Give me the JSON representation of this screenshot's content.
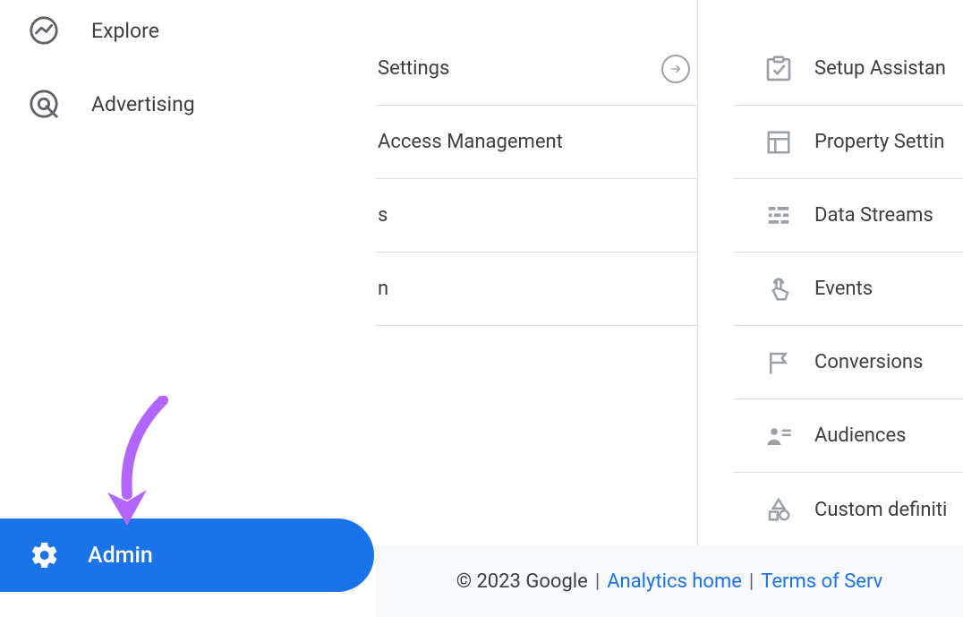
{
  "sidebar": {
    "explore_label": "Explore",
    "advertising_label": "Advertising",
    "admin_label": "Admin"
  },
  "middle": {
    "items": [
      {
        "label": "Settings",
        "show_move": true
      },
      {
        "label": "Access Management"
      },
      {
        "label": "s"
      },
      {
        "label": "n"
      }
    ]
  },
  "right": {
    "items": [
      {
        "label": "Setup Assistan"
      },
      {
        "label": "Property Settin"
      },
      {
        "label": "Data Streams"
      },
      {
        "label": "Events"
      },
      {
        "label": "Conversions"
      },
      {
        "label": "Audiences"
      },
      {
        "label": "Custom definiti"
      }
    ]
  },
  "footer": {
    "copyright": "© 2023 Google",
    "link_home": "Analytics home",
    "link_terms": "Terms of Serv"
  }
}
